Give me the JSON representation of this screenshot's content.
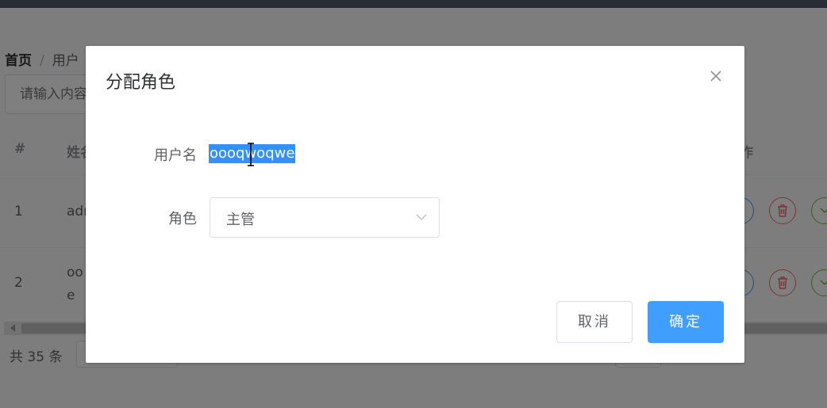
{
  "breadcrumb": {
    "home": "首页",
    "separator": "/",
    "current": "用户"
  },
  "search": {
    "placeholder": "请输入内容"
  },
  "table": {
    "headers": [
      "#",
      "姓名",
      "作"
    ],
    "rows": [
      {
        "index": "1",
        "name": "adr"
      },
      {
        "index": "2",
        "name_line1": "oo",
        "name_line2": "e"
      }
    ]
  },
  "pagination": {
    "total": "共 35 条"
  },
  "dialog": {
    "title": "分配角色",
    "username_label": "用户名",
    "username_value": "oooqwoqwe",
    "role_label": "角色",
    "role_value": "主管",
    "cancel_label": "取消",
    "confirm_label": "确定"
  },
  "colors": {
    "primary": "#409eff",
    "danger": "#f56c6c",
    "success": "#67c23a",
    "selection": "#3390ff",
    "overlay": "rgba(0,0,0,0.5)"
  },
  "icons": {
    "close": "close-icon",
    "select_arrow": "chevron-down-icon",
    "edit": "edit-icon",
    "delete": "trash-icon",
    "more": "chevron-down-icon",
    "cursor": "text-cursor-icon"
  }
}
